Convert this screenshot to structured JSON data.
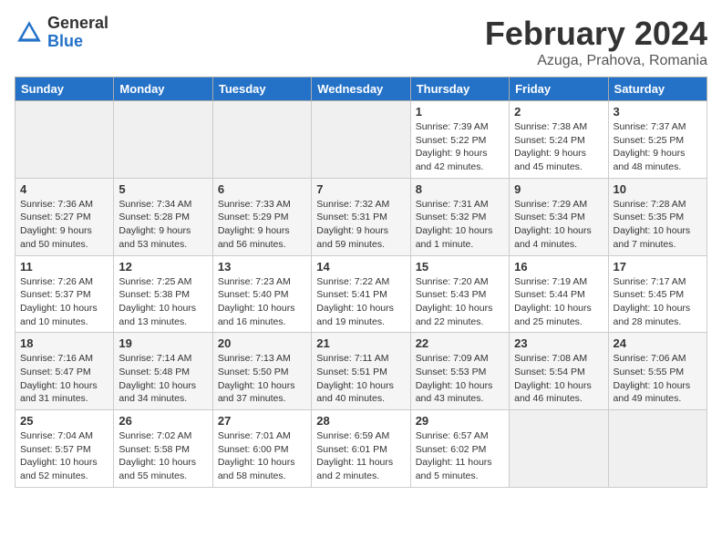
{
  "logo": {
    "general": "General",
    "blue": "Blue"
  },
  "title": "February 2024",
  "location": "Azuga, Prahova, Romania",
  "days_of_week": [
    "Sunday",
    "Monday",
    "Tuesday",
    "Wednesday",
    "Thursday",
    "Friday",
    "Saturday"
  ],
  "weeks": [
    [
      {
        "day": "",
        "info": ""
      },
      {
        "day": "",
        "info": ""
      },
      {
        "day": "",
        "info": ""
      },
      {
        "day": "",
        "info": ""
      },
      {
        "day": "1",
        "info": "Sunrise: 7:39 AM\nSunset: 5:22 PM\nDaylight: 9 hours\nand 42 minutes."
      },
      {
        "day": "2",
        "info": "Sunrise: 7:38 AM\nSunset: 5:24 PM\nDaylight: 9 hours\nand 45 minutes."
      },
      {
        "day": "3",
        "info": "Sunrise: 7:37 AM\nSunset: 5:25 PM\nDaylight: 9 hours\nand 48 minutes."
      }
    ],
    [
      {
        "day": "4",
        "info": "Sunrise: 7:36 AM\nSunset: 5:27 PM\nDaylight: 9 hours\nand 50 minutes."
      },
      {
        "day": "5",
        "info": "Sunrise: 7:34 AM\nSunset: 5:28 PM\nDaylight: 9 hours\nand 53 minutes."
      },
      {
        "day": "6",
        "info": "Sunrise: 7:33 AM\nSunset: 5:29 PM\nDaylight: 9 hours\nand 56 minutes."
      },
      {
        "day": "7",
        "info": "Sunrise: 7:32 AM\nSunset: 5:31 PM\nDaylight: 9 hours\nand 59 minutes."
      },
      {
        "day": "8",
        "info": "Sunrise: 7:31 AM\nSunset: 5:32 PM\nDaylight: 10 hours\nand 1 minute."
      },
      {
        "day": "9",
        "info": "Sunrise: 7:29 AM\nSunset: 5:34 PM\nDaylight: 10 hours\nand 4 minutes."
      },
      {
        "day": "10",
        "info": "Sunrise: 7:28 AM\nSunset: 5:35 PM\nDaylight: 10 hours\nand 7 minutes."
      }
    ],
    [
      {
        "day": "11",
        "info": "Sunrise: 7:26 AM\nSunset: 5:37 PM\nDaylight: 10 hours\nand 10 minutes."
      },
      {
        "day": "12",
        "info": "Sunrise: 7:25 AM\nSunset: 5:38 PM\nDaylight: 10 hours\nand 13 minutes."
      },
      {
        "day": "13",
        "info": "Sunrise: 7:23 AM\nSunset: 5:40 PM\nDaylight: 10 hours\nand 16 minutes."
      },
      {
        "day": "14",
        "info": "Sunrise: 7:22 AM\nSunset: 5:41 PM\nDaylight: 10 hours\nand 19 minutes."
      },
      {
        "day": "15",
        "info": "Sunrise: 7:20 AM\nSunset: 5:43 PM\nDaylight: 10 hours\nand 22 minutes."
      },
      {
        "day": "16",
        "info": "Sunrise: 7:19 AM\nSunset: 5:44 PM\nDaylight: 10 hours\nand 25 minutes."
      },
      {
        "day": "17",
        "info": "Sunrise: 7:17 AM\nSunset: 5:45 PM\nDaylight: 10 hours\nand 28 minutes."
      }
    ],
    [
      {
        "day": "18",
        "info": "Sunrise: 7:16 AM\nSunset: 5:47 PM\nDaylight: 10 hours\nand 31 minutes."
      },
      {
        "day": "19",
        "info": "Sunrise: 7:14 AM\nSunset: 5:48 PM\nDaylight: 10 hours\nand 34 minutes."
      },
      {
        "day": "20",
        "info": "Sunrise: 7:13 AM\nSunset: 5:50 PM\nDaylight: 10 hours\nand 37 minutes."
      },
      {
        "day": "21",
        "info": "Sunrise: 7:11 AM\nSunset: 5:51 PM\nDaylight: 10 hours\nand 40 minutes."
      },
      {
        "day": "22",
        "info": "Sunrise: 7:09 AM\nSunset: 5:53 PM\nDaylight: 10 hours\nand 43 minutes."
      },
      {
        "day": "23",
        "info": "Sunrise: 7:08 AM\nSunset: 5:54 PM\nDaylight: 10 hours\nand 46 minutes."
      },
      {
        "day": "24",
        "info": "Sunrise: 7:06 AM\nSunset: 5:55 PM\nDaylight: 10 hours\nand 49 minutes."
      }
    ],
    [
      {
        "day": "25",
        "info": "Sunrise: 7:04 AM\nSunset: 5:57 PM\nDaylight: 10 hours\nand 52 minutes."
      },
      {
        "day": "26",
        "info": "Sunrise: 7:02 AM\nSunset: 5:58 PM\nDaylight: 10 hours\nand 55 minutes."
      },
      {
        "day": "27",
        "info": "Sunrise: 7:01 AM\nSunset: 6:00 PM\nDaylight: 10 hours\nand 58 minutes."
      },
      {
        "day": "28",
        "info": "Sunrise: 6:59 AM\nSunset: 6:01 PM\nDaylight: 11 hours\nand 2 minutes."
      },
      {
        "day": "29",
        "info": "Sunrise: 6:57 AM\nSunset: 6:02 PM\nDaylight: 11 hours\nand 5 minutes."
      },
      {
        "day": "",
        "info": ""
      },
      {
        "day": "",
        "info": ""
      }
    ]
  ]
}
